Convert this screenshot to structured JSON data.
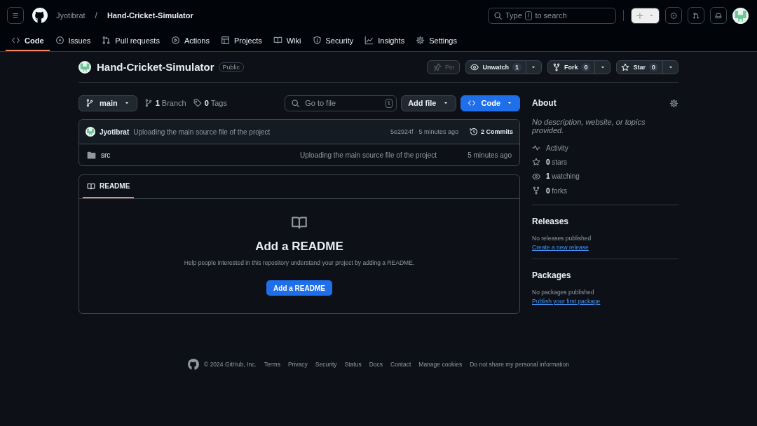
{
  "header": {
    "owner": "Jyotibrat",
    "separator": "/",
    "repo": "Hand-Cricket-Simulator",
    "search": {
      "prefix": "Type",
      "key": "/",
      "suffix": "to search"
    }
  },
  "tabs": [
    {
      "label": "Code",
      "selected": true
    },
    {
      "label": "Issues",
      "selected": false
    },
    {
      "label": "Pull requests",
      "selected": false
    },
    {
      "label": "Actions",
      "selected": false
    },
    {
      "label": "Projects",
      "selected": false
    },
    {
      "label": "Wiki",
      "selected": false
    },
    {
      "label": "Security",
      "selected": false
    },
    {
      "label": "Insights",
      "selected": false
    },
    {
      "label": "Settings",
      "selected": false
    }
  ],
  "repo": {
    "name": "Hand-Cricket-Simulator",
    "visibility": "Public",
    "pin": {
      "label": "Pin",
      "disabled": true
    },
    "unwatch": {
      "label": "Unwatch",
      "count": "1"
    },
    "fork": {
      "label": "Fork",
      "count": "0"
    },
    "star": {
      "label": "Star",
      "count": "0"
    }
  },
  "toolbar": {
    "branch": "main",
    "branches": {
      "count": "1",
      "label": "Branch"
    },
    "tags": {
      "count": "0",
      "label": "Tags"
    },
    "go_to_file": {
      "placeholder": "Go to file",
      "key": "t"
    },
    "add_file": "Add file",
    "code": "Code"
  },
  "commit": {
    "author": "Jyotibrat",
    "message": "Uploading the main source file of the project",
    "meta": "5e2924f · 5 minutes ago",
    "commits": "2 Commits"
  },
  "files": [
    {
      "kind": "folder",
      "name": "src",
      "message": "Uploading the main source file of the project",
      "time": "5 minutes ago"
    }
  ],
  "readme": {
    "tab": "README",
    "title": "Add a README",
    "text": "Help people interested in this repository understand your project by adding a README.",
    "button": "Add a README"
  },
  "about": {
    "title": "About",
    "description": "No description, website, or topics provided.",
    "stats": [
      {
        "label": "Activity"
      },
      {
        "count": "0",
        "label": "stars"
      },
      {
        "count": "1",
        "label": "watching"
      },
      {
        "count": "0",
        "label": "forks"
      }
    ]
  },
  "releases": {
    "title": "Releases",
    "text": "No releases published",
    "link": "Create a new release"
  },
  "packages": {
    "title": "Packages",
    "text": "No packages published",
    "link": "Publish your first package"
  },
  "footer": {
    "copyright": "© 2024 GitHub, Inc.",
    "links": [
      "Terms",
      "Privacy",
      "Security",
      "Status",
      "Docs",
      "Contact",
      "Manage cookies",
      "Do not share my personal information"
    ]
  }
}
